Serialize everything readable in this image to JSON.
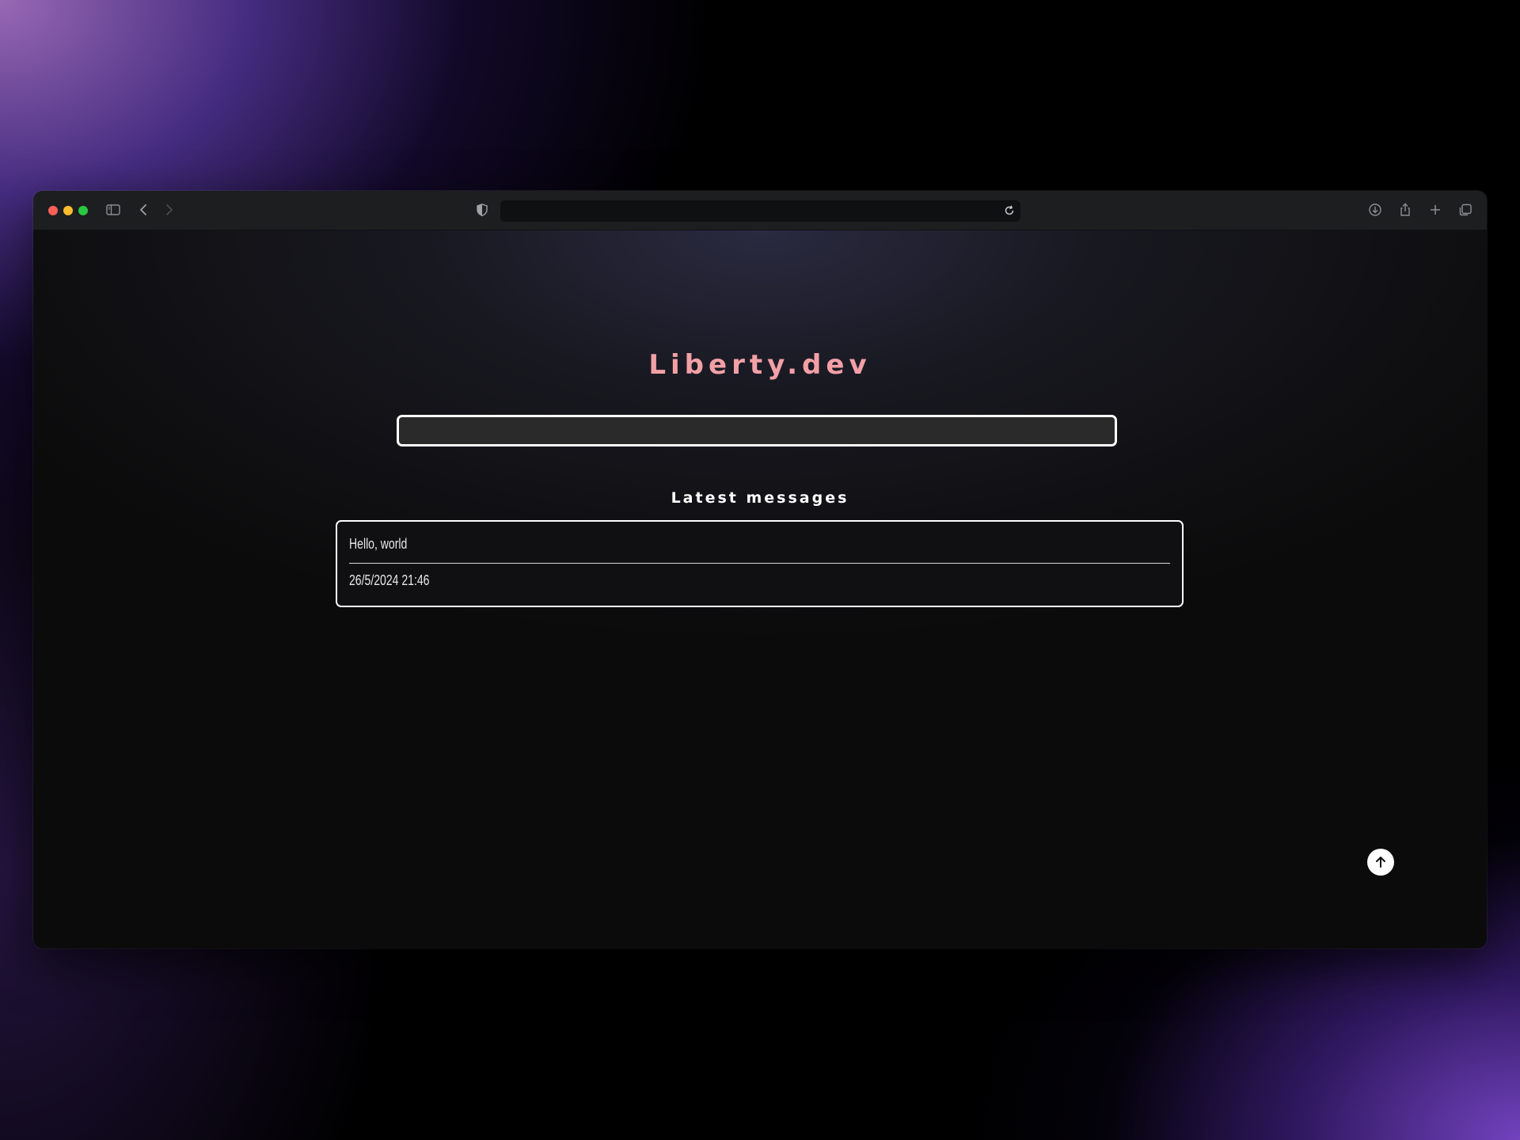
{
  "browser": {
    "address": "",
    "icons": {
      "sidebar": "sidebar-icon",
      "back": "chevron-left-icon",
      "forward": "chevron-right-icon",
      "privacy": "shield-icon",
      "reload": "reload-icon",
      "downloads": "download-icon",
      "share": "share-icon",
      "new_tab": "plus-icon",
      "tabs": "tabs-overview-icon"
    }
  },
  "page": {
    "site_title": "Liberty.dev",
    "message_input": {
      "value": "",
      "placeholder": ""
    },
    "section_title": "Latest messages",
    "messages": [
      {
        "text": "Hello, world",
        "timestamp": "26/5/2024 21:46"
      }
    ],
    "scroll_top_icon": "arrow-up-icon"
  },
  "colors": {
    "title": "#f2a0a6",
    "card_border": "#ffffff",
    "input_bg": "#2a2a2a"
  }
}
